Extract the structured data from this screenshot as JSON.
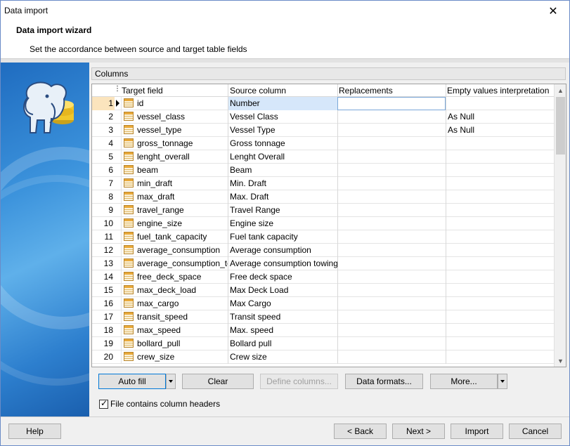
{
  "window": {
    "title": "Data import",
    "close_glyph": "✕"
  },
  "header": {
    "title": "Data import wizard",
    "subtitle": "Set the accordance between source and target table fields"
  },
  "group": {
    "label": "Columns"
  },
  "grid": {
    "columns": [
      "Target field",
      "Source column",
      "Replacements",
      "Empty values interpretation"
    ],
    "rows": [
      {
        "num": "1",
        "target": "id",
        "source": "Number",
        "replacements": "",
        "empty": ""
      },
      {
        "num": "2",
        "target": "vessel_class",
        "source": "Vessel Class",
        "replacements": "",
        "empty": "As Null"
      },
      {
        "num": "3",
        "target": "vessel_type",
        "source": "Vessel Type",
        "replacements": "",
        "empty": "As Null"
      },
      {
        "num": "4",
        "target": "gross_tonnage",
        "source": "Gross tonnage",
        "replacements": "",
        "empty": ""
      },
      {
        "num": "5",
        "target": "lenght_overall",
        "source": "Lenght Overall",
        "replacements": "",
        "empty": ""
      },
      {
        "num": "6",
        "target": "beam",
        "source": "Beam",
        "replacements": "",
        "empty": ""
      },
      {
        "num": "7",
        "target": "min_draft",
        "source": "Min. Draft",
        "replacements": "",
        "empty": ""
      },
      {
        "num": "8",
        "target": "max_draft",
        "source": "Max. Draft",
        "replacements": "",
        "empty": ""
      },
      {
        "num": "9",
        "target": "travel_range",
        "source": "Travel Range",
        "replacements": "",
        "empty": ""
      },
      {
        "num": "10",
        "target": "engine_size",
        "source": "Engine size",
        "replacements": "",
        "empty": ""
      },
      {
        "num": "11",
        "target": "fuel_tank_capacity",
        "source": "Fuel tank capacity",
        "replacements": "",
        "empty": ""
      },
      {
        "num": "12",
        "target": "average_consumption",
        "source": "Average consumption",
        "replacements": "",
        "empty": ""
      },
      {
        "num": "13",
        "target": "average_consumption_tow",
        "source": "Average consumption towing",
        "replacements": "",
        "empty": ""
      },
      {
        "num": "14",
        "target": "free_deck_space",
        "source": "Free deck space",
        "replacements": "",
        "empty": ""
      },
      {
        "num": "15",
        "target": "max_deck_load",
        "source": "Max Deck Load",
        "replacements": "",
        "empty": ""
      },
      {
        "num": "16",
        "target": "max_cargo",
        "source": "Max Cargo",
        "replacements": "",
        "empty": ""
      },
      {
        "num": "17",
        "target": "transit_speed",
        "source": "Transit speed",
        "replacements": "",
        "empty": ""
      },
      {
        "num": "18",
        "target": "max_speed",
        "source": "Max. speed",
        "replacements": "",
        "empty": ""
      },
      {
        "num": "19",
        "target": "bollard_pull",
        "source": "Bollard pull",
        "replacements": "",
        "empty": ""
      },
      {
        "num": "20",
        "target": "crew_size",
        "source": "Crew size",
        "replacements": "",
        "empty": ""
      }
    ]
  },
  "toolbar": {
    "auto_fill": "Auto fill",
    "clear": "Clear",
    "define_columns": "Define columns...",
    "data_formats": "Data formats...",
    "more": "More..."
  },
  "checkbox": {
    "label": "File contains column headers",
    "checked": true
  },
  "footer": {
    "help": "Help",
    "back": "< Back",
    "next": "Next >",
    "import": "Import",
    "cancel": "Cancel"
  },
  "colors": {
    "accent": "#0078d7",
    "selected_row_num": "#fbe4bd",
    "selected_cell": "#d6e7fa"
  }
}
